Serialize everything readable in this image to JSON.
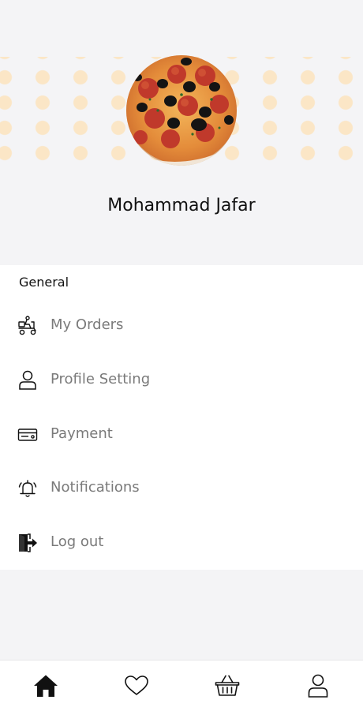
{
  "profile": {
    "name": "Mohammad Jafar",
    "avatar_icon": "pizza-photo"
  },
  "menu": {
    "section_title": "General",
    "items": [
      {
        "label": "My Orders",
        "icon": "delivery-scooter-icon"
      },
      {
        "label": "Profile Setting",
        "icon": "user-icon"
      },
      {
        "label": "Payment",
        "icon": "credit-card-icon"
      },
      {
        "label": "Notifications",
        "icon": "alarm-bell-icon"
      },
      {
        "label": "Log out",
        "icon": "logout-door-icon"
      }
    ]
  },
  "bottom_nav": {
    "items": [
      {
        "icon": "home-icon",
        "active": true
      },
      {
        "icon": "heart-icon",
        "active": false
      },
      {
        "icon": "basket-icon",
        "active": false
      },
      {
        "icon": "user-icon",
        "active": false
      }
    ]
  },
  "colors": {
    "background": "#f4f4f6",
    "dot_pattern": "#fbe6c6",
    "label_text": "#7a7a7a"
  }
}
